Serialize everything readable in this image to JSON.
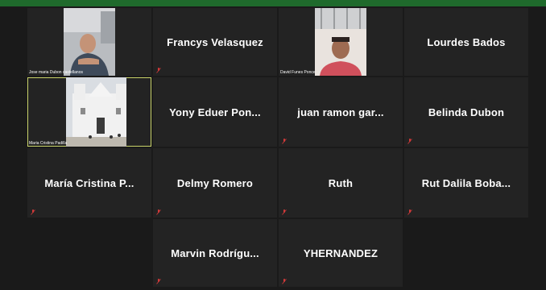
{
  "participants": [
    {
      "name": "Jose maria Dubon castellanos",
      "video": true,
      "avatar": "video-man-1"
    },
    {
      "name": "Francys Velasquez",
      "video": false
    },
    {
      "name": "David Funes Ponce",
      "video": true,
      "avatar": "video-man-2"
    },
    {
      "name": "Lourdes Bados",
      "video": false
    },
    {
      "name": "Maria Cristina Padilla",
      "video": true,
      "avatar": "video-church"
    },
    {
      "name": "Yony Eduer Pon...",
      "video": false
    },
    {
      "name": "juan ramon gar...",
      "video": false
    },
    {
      "name": "Belinda Dubon",
      "video": false
    },
    {
      "name": "María Cristina P...",
      "video": false
    },
    {
      "name": "Delmy Romero",
      "video": false
    },
    {
      "name": "Ruth",
      "video": false
    },
    {
      "name": "Rut Dalila Boba...",
      "video": false
    },
    {
      "name": "Marvin Rodrígu...",
      "video": false
    },
    {
      "name": "YHERNANDEZ",
      "video": false
    }
  ],
  "colors": {
    "topbar": "#1f6a2c",
    "active_border": "#c9d36a",
    "muted_mic": "#d23a3a"
  },
  "icons": {
    "mic": "muted-microphone-icon"
  }
}
